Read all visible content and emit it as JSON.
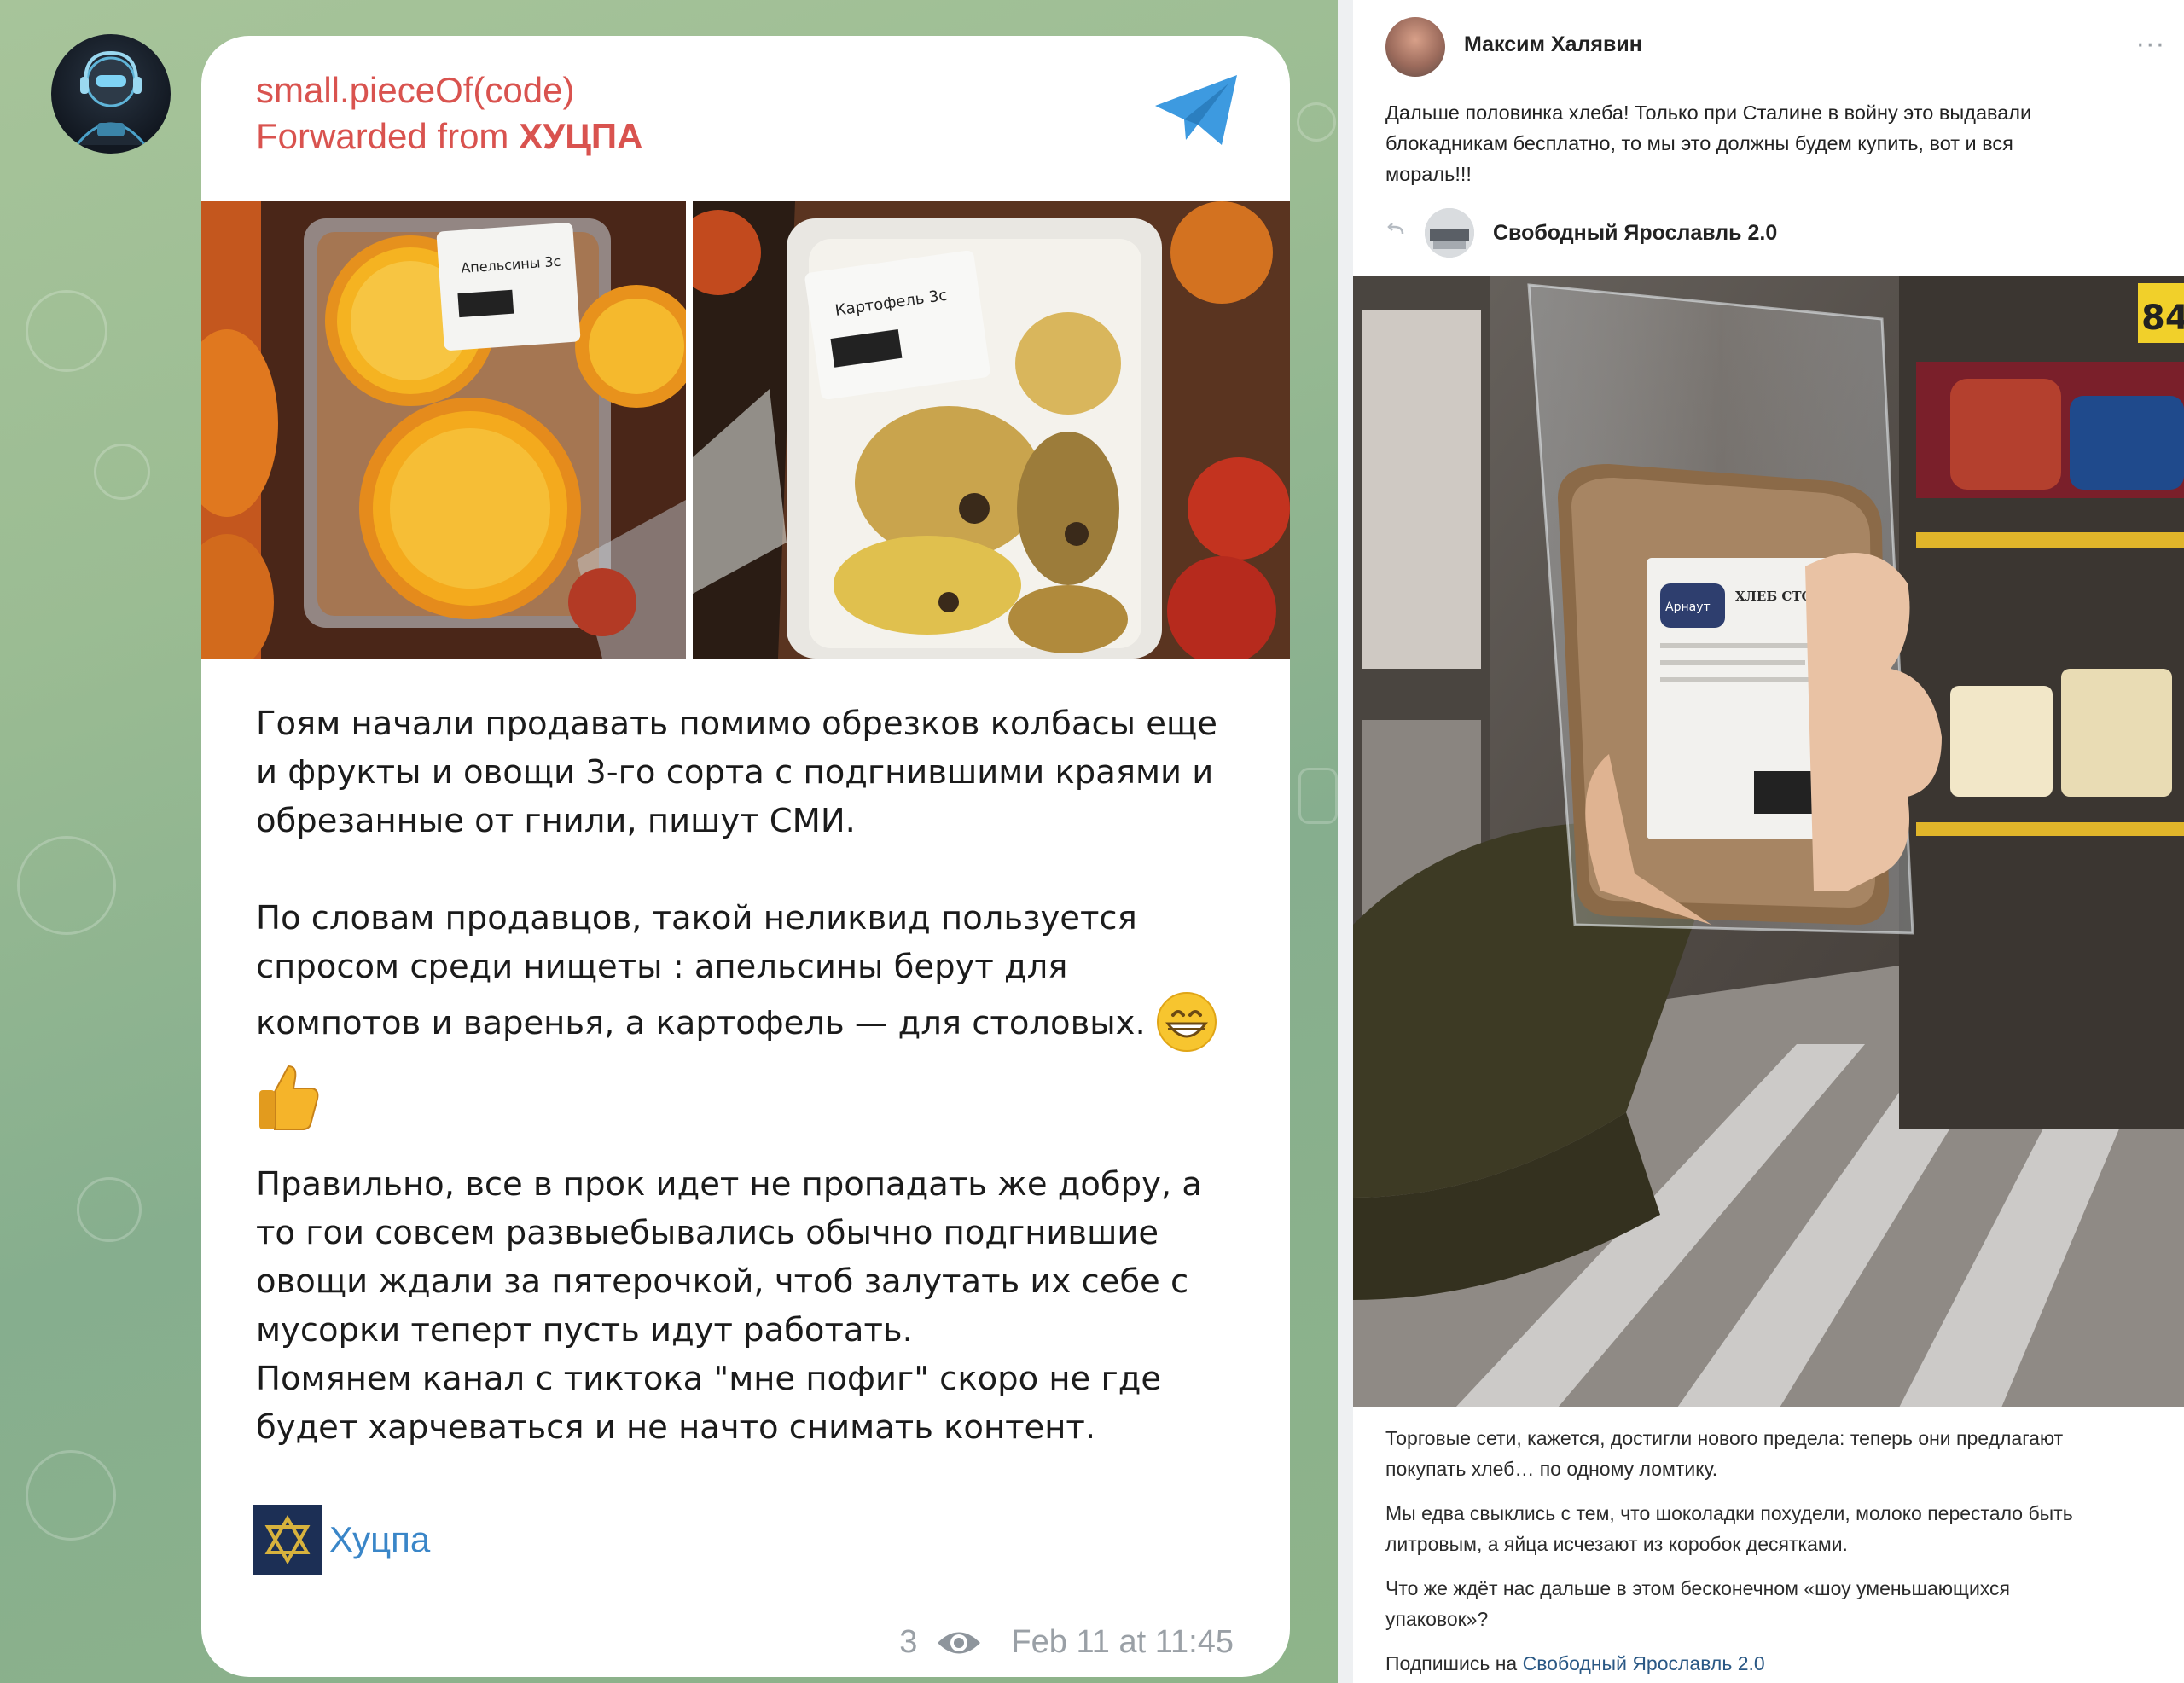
{
  "telegram": {
    "channel_name": "small.pieceOf(code)",
    "forwarded_prefix": "Forwarded from",
    "forwarded_source": "ХУЦПА",
    "photo_labels": [
      "Апельсины 3с",
      "Картофель 3с"
    ],
    "paragraphs": [
      "Гоям начали продавать помимо обрезков колбасы еще\nи фрукты и овощи 3-го сорта с подгнившими краями и\nобрезанные от гнили, пишут СМИ.",
      "По словам продавцов, такой неликвид пользуется\nспросом среди нищеты : апельсины берут для\nкомпотов и варенья, а картофель — для столовых.",
      "Правильно, все в прок идет не пропадать же добру, а\nто гои совсем развыебывались обычно подгнившие\nовощи ждали за пятерочкой, чтоб залутать их себе с\nмусорки теперт пусть идут работать.",
      "Помянем канал с тиктока \"мне пофиг\" скоро не где\nбудет харчеваться и не начто снимать контент."
    ],
    "signature": "Хуцпа",
    "views": "3",
    "timestamp": "Feb 11 at 11:45"
  },
  "vk": {
    "author": "Максим Халявин",
    "more_label": "···",
    "post_text": "Дальше половинка хлеба! Только при Сталине в войну это выдавали\nблокадникам бесплатно, то мы это должны будем купить, вот и вся\nмораль!!!",
    "repost_source": "Свободный Ярославль 2.0",
    "photo_texts": {
      "product_title": "ХЛЕБ СТОЛИЧНЫЙ",
      "brand": "Арнаут",
      "price_tag": "84"
    },
    "caption": [
      "Торговые сети, кажется, достигли нового предела: теперь они предлагают\nпокупать хлеб… по одному ломтику.",
      "Мы едва свыклись с тем, что шоколадки похудели, молоко перестало быть\nлитровым, а яйца исчезают из коробок десятками.",
      "Что же ждёт нас дальше в этом бесконечном «шоу уменьшающихся\nупаковок»?"
    ],
    "subscribe_prefix": "Подпишись на",
    "subscribe_link": "Свободный Ярославль 2.0"
  },
  "colors": {
    "telegram_name": "#d9534f",
    "telegram_plane": "#3d9ae0",
    "signature_link": "#3a86c8",
    "vk_link": "#2a5885"
  },
  "icons": [
    "telegram-plane-icon",
    "eye-icon",
    "grinning-emoji-icon",
    "thumbs-up-emoji-icon",
    "star-of-david-icon",
    "repost-icon"
  ]
}
